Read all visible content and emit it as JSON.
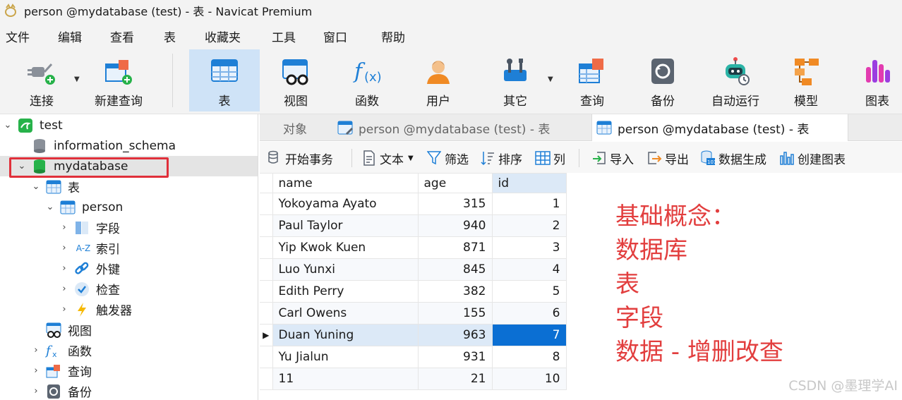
{
  "window": {
    "title": "person @mydatabase (test) - 表 - Navicat Premium"
  },
  "menu": [
    "文件",
    "编辑",
    "查看",
    "表",
    "收藏夹",
    "工具",
    "窗口",
    "帮助"
  ],
  "toolbar": {
    "connect": "连接",
    "new_query": "新建查询",
    "table": "表",
    "view": "视图",
    "function": "函数",
    "user": "用户",
    "other": "其它",
    "query": "查询",
    "backup": "备份",
    "automation": "自动运行",
    "model": "模型",
    "chart": "图表"
  },
  "tree": {
    "connection": "test",
    "db_info": "information_schema",
    "db_selected": "mydatabase",
    "tables_group": "表",
    "table_person": "person",
    "fields": "字段",
    "indexes": "索引",
    "foreign_keys": "外键",
    "checks": "检查",
    "triggers": "触发器",
    "views": "视图",
    "functions": "函数",
    "queries": "查询",
    "backups": "备份",
    "index_badge": "A-Z"
  },
  "tabs": {
    "objects": "对象",
    "tab1": "person @mydatabase (test) - 表",
    "tab2": "person @mydatabase (test) - 表"
  },
  "subbar": {
    "begin_tx": "开始事务",
    "text": "文本",
    "filter": "筛选",
    "sort": "排序",
    "columns": "列",
    "import": "导入",
    "export": "导出",
    "generate": "数据生成",
    "create_chart": "创建图表"
  },
  "grid": {
    "headers": [
      "name",
      "age",
      "id"
    ],
    "rows": [
      [
        "Yokoyama Ayato",
        "315",
        "1"
      ],
      [
        "Paul Taylor",
        "940",
        "2"
      ],
      [
        "Yip Kwok Kuen",
        "871",
        "3"
      ],
      [
        "Luo Yunxi",
        "845",
        "4"
      ],
      [
        "Edith Perry",
        "382",
        "5"
      ],
      [
        "Carl Owens",
        "155",
        "6"
      ],
      [
        "Duan Yuning",
        "963",
        "7"
      ],
      [
        "Yu Jialun",
        "931",
        "8"
      ],
      [
        "11",
        "21",
        "10"
      ]
    ]
  },
  "annotation": {
    "line1": "基础概念：",
    "line2": "数据库",
    "line3": "表",
    "line4": "字段",
    "line5": "数据 - 增删改查"
  },
  "watermark": "CSDN @墨理学AI",
  "colors": {
    "accent_blue": "#0b6fd3",
    "selection_blue": "#dce9f7",
    "annotation_red": "#e23e3e",
    "highlight_box_red": "#e0303b"
  }
}
